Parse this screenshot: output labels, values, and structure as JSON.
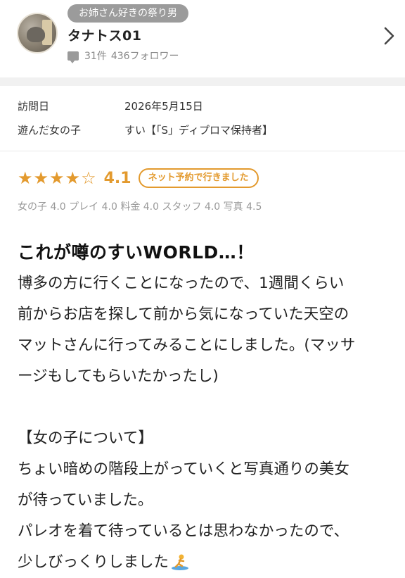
{
  "user": {
    "title_badge": "お姉さん好きの祭り男",
    "name": "タナトス01",
    "review_count": "31件",
    "followers": "436フォロワー"
  },
  "visit": {
    "date_label": "訪問日",
    "date_value": "2026年5月15日",
    "girl_label": "遊んだ女の子",
    "girl_value": "すい【「S」ディプロマ保持者】"
  },
  "rating": {
    "score": "4.1",
    "stars_filled": 4,
    "stars_total": 5,
    "badge": "ネット予約で行きました",
    "subscores": "女の子 4.0 プレイ 4.0 料金 4.0 スタッフ 4.0 写真 4.5"
  },
  "review": {
    "title": "これが噂のすいWORLD…！",
    "lines": [
      "博多の方に行くことになったので、1週間くらい",
      "前からお店を探して前から気になっていた天空の",
      "マットさんに行ってみることにしました。(マッサ",
      "ージもしてもらいたかったし)",
      "",
      "【女の子について】",
      "ちょい暗めの階段上がっていくと写真通りの美女",
      "が待っていました。",
      "パレオを着て待っているとは思わなかったので、",
      "少しびっくりしました"
    ]
  },
  "icons": {
    "chevron": "chevron-right-icon",
    "comment": "comment-icon",
    "star": "star-icon",
    "emoji": "surfer-emoji"
  },
  "colors": {
    "accent": "#e39a2e",
    "badge_gray": "#9b9b9b"
  }
}
